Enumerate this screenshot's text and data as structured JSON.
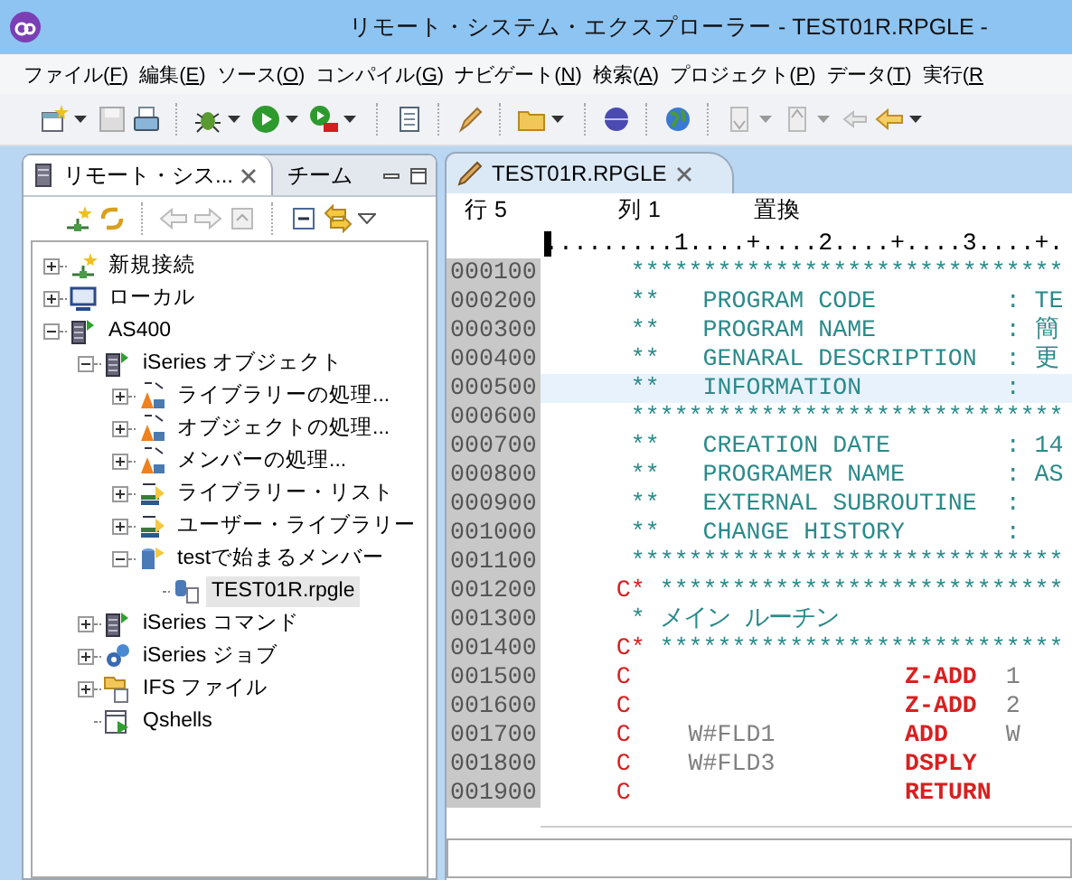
{
  "window": {
    "title": "リモート・システム・エクスプローラー - TEST01R.RPGLE -"
  },
  "menu": [
    {
      "pre": "ファイル(",
      "key": "F",
      "post": ")"
    },
    {
      "pre": "編集(",
      "key": "E",
      "post": ")"
    },
    {
      "pre": "ソース(",
      "key": "O",
      "post": ")"
    },
    {
      "pre": "コンパイル(",
      "key": "G",
      "post": ")"
    },
    {
      "pre": "ナビゲート(",
      "key": "N",
      "post": ")"
    },
    {
      "pre": "検索(",
      "key": "A",
      "post": ")"
    },
    {
      "pre": "プロジェクト(",
      "key": "P",
      "post": ")"
    },
    {
      "pre": "データ(",
      "key": "T",
      "post": ")"
    },
    {
      "pre": "実行(",
      "key": "R"
    }
  ],
  "left_panel": {
    "tabs": [
      {
        "label": "リモート・シス...",
        "selected": true
      },
      {
        "label": "チーム",
        "selected": false
      }
    ],
    "tree": [
      {
        "label": "新規接続",
        "kind": "connection",
        "expanded": false,
        "selected": false
      },
      {
        "label": "ローカル",
        "kind": "computer",
        "expanded": false,
        "selected": false
      },
      {
        "label": "AS400",
        "kind": "server",
        "expanded": true,
        "selected": false,
        "children": [
          {
            "label": "iSeries オブジェクト",
            "kind": "objects",
            "expanded": true,
            "selected": false,
            "children": [
              {
                "label": "ライブラリーの処理...",
                "kind": "filter",
                "expanded": false,
                "selected": false
              },
              {
                "label": "オブジェクトの処理...",
                "kind": "filter",
                "expanded": false,
                "selected": false
              },
              {
                "label": "メンバーの処理...",
                "kind": "filter",
                "expanded": false,
                "selected": false
              },
              {
                "label": "ライブラリー・リスト",
                "kind": "list",
                "expanded": false,
                "selected": false
              },
              {
                "label": "ユーザー・ライブラリー",
                "kind": "list",
                "expanded": false,
                "selected": false
              },
              {
                "label": "testで始まるメンバー",
                "kind": "member-filter",
                "expanded": true,
                "selected": false,
                "children": [
                  {
                    "label": "TEST01R.rpgle",
                    "kind": "source",
                    "selected": true
                  }
                ]
              }
            ]
          },
          {
            "label": "iSeries コマンド",
            "kind": "command",
            "expanded": false,
            "selected": false
          },
          {
            "label": "iSeries ジョブ",
            "kind": "jobs",
            "expanded": false,
            "selected": false
          },
          {
            "label": "IFS ファイル",
            "kind": "ifs",
            "expanded": false,
            "selected": false
          },
          {
            "label": "Qshells",
            "kind": "shell",
            "selected": false
          }
        ]
      }
    ]
  },
  "editor": {
    "tab": {
      "label": "TEST01R.RPGLE",
      "selected": true
    },
    "status": [
      "行 5",
      "列 1",
      "置換"
    ],
    "ruler": ".........1....+....2....+....3....+.",
    "lines": [
      {
        "seq": "000100",
        "current": false,
        "parts": [
          {
            "kind": "comment",
            "text": "      ******************************"
          }
        ]
      },
      {
        "seq": "000200",
        "current": false,
        "parts": [
          {
            "kind": "comment",
            "text": "      **   PROGRAM CODE         : TE"
          }
        ]
      },
      {
        "seq": "000300",
        "current": false,
        "parts": [
          {
            "kind": "comment",
            "text": "      **   PROGRAM NAME         : 簡"
          }
        ]
      },
      {
        "seq": "000400",
        "current": false,
        "parts": [
          {
            "kind": "comment",
            "text": "      **   GENARAL DESCRIPTION  : 更"
          }
        ]
      },
      {
        "seq": "000500",
        "current": true,
        "parts": [
          {
            "kind": "comment",
            "text": "      **   INFORMATION          :"
          }
        ]
      },
      {
        "seq": "000600",
        "current": false,
        "parts": [
          {
            "kind": "comment",
            "text": "      ******************************"
          }
        ]
      },
      {
        "seq": "000700",
        "current": false,
        "parts": [
          {
            "kind": "comment",
            "text": "      **   CREATION DATE        : 14"
          }
        ]
      },
      {
        "seq": "000800",
        "current": false,
        "parts": [
          {
            "kind": "comment",
            "text": "      **   PROGRAMER NAME       : AS"
          }
        ]
      },
      {
        "seq": "000900",
        "current": false,
        "parts": [
          {
            "kind": "comment",
            "text": "      **   EXTERNAL SUBROUTINE  :"
          }
        ]
      },
      {
        "seq": "001000",
        "current": false,
        "parts": [
          {
            "kind": "comment",
            "text": "      **   CHANGE HISTORY       :"
          }
        ]
      },
      {
        "seq": "001100",
        "current": false,
        "parts": [
          {
            "kind": "comment",
            "text": "      ******************************"
          }
        ]
      },
      {
        "seq": "001200",
        "current": false,
        "parts": [
          {
            "kind": "spec",
            "text": "     C*"
          },
          {
            "kind": "comment",
            "text": " ****************************"
          }
        ]
      },
      {
        "seq": "001300",
        "current": false,
        "parts": [
          {
            "kind": "comment",
            "text": "      * メイン ルーチン"
          }
        ]
      },
      {
        "seq": "001400",
        "current": false,
        "parts": [
          {
            "kind": "spec",
            "text": "     C*"
          },
          {
            "kind": "comment",
            "text": " ****************************"
          }
        ]
      },
      {
        "seq": "001500",
        "current": false,
        "parts": [
          {
            "kind": "spec",
            "text": "     C"
          },
          {
            "kind": "opcode",
            "text": "                   Z-ADD"
          },
          {
            "kind": "field",
            "text": "  1"
          }
        ]
      },
      {
        "seq": "001600",
        "current": false,
        "parts": [
          {
            "kind": "spec",
            "text": "     C"
          },
          {
            "kind": "opcode",
            "text": "                   Z-ADD"
          },
          {
            "kind": "field",
            "text": "  2"
          }
        ]
      },
      {
        "seq": "001700",
        "current": false,
        "parts": [
          {
            "kind": "spec",
            "text": "     C"
          },
          {
            "kind": "field",
            "text": "    W#FLD1"
          },
          {
            "kind": "opcode",
            "text": "         ADD"
          },
          {
            "kind": "field",
            "text": "    W"
          }
        ]
      },
      {
        "seq": "001800",
        "current": false,
        "parts": [
          {
            "kind": "spec",
            "text": "     C"
          },
          {
            "kind": "field",
            "text": "    W#FLD3"
          },
          {
            "kind": "opcode",
            "text": "         DSPLY"
          }
        ]
      },
      {
        "seq": "001900",
        "current": false,
        "parts": [
          {
            "kind": "spec",
            "text": "     C"
          },
          {
            "kind": "opcode",
            "text": "                   RETURN"
          }
        ]
      }
    ]
  }
}
